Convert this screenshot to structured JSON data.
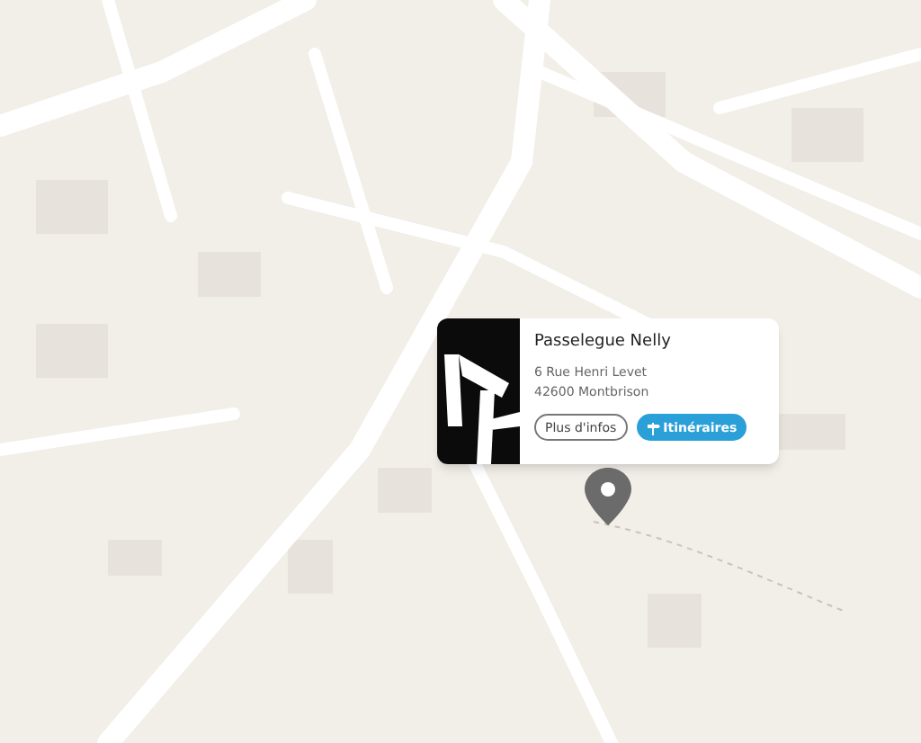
{
  "place": {
    "name": "Passelegue Nelly",
    "address_lines": [
      "6 Rue Henri Levet",
      "42600 Montbrison"
    ]
  },
  "buttons": [
    {
      "label": "Plus d'infos",
      "kind": "outline"
    },
    {
      "label": "Itinéraires",
      "kind": "primary"
    }
  ]
}
